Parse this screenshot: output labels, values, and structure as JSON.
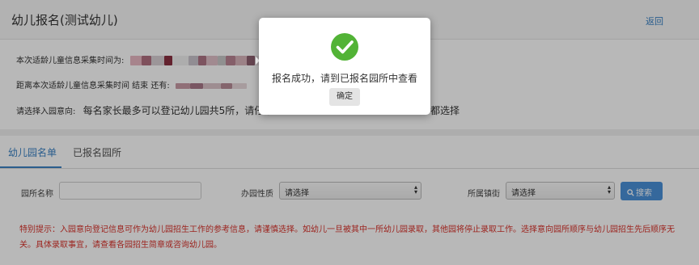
{
  "header": {
    "title": "幼儿报名(测试幼儿)",
    "back_label": "返回"
  },
  "info": {
    "collect_time_label": "本次适龄儿童信息采集时间为:",
    "remaining_label": "距离本次适龄儿童信息采集时间 结束 还有:",
    "select_label": "请选择入园意向:",
    "select_hint_visible": "每名家长最多可以登记幼儿园共5所，请仔细",
    "select_hint_tail": "都选择"
  },
  "tabs": [
    {
      "label": "幼儿园名单",
      "active": true
    },
    {
      "label": "已报名园所",
      "active": false
    }
  ],
  "filters": {
    "name_label": "园所名称",
    "name_value": "",
    "type_label": "办园性质",
    "type_value": "请选择",
    "town_label": "所属镇街",
    "town_value": "请选择",
    "search_label": "搜索"
  },
  "notice": {
    "text": "特别提示：入园意向登记信息可作为幼儿园招生工作的参考信息，请谨慎选择。如幼儿一旦被其中一所幼儿园录取，其他园将停止录取工作。选择意向园所顺序与幼儿园招生先后顺序无关。具体录取事宜，请查看各园招生简章或咨询幼儿园。"
  },
  "modal": {
    "icon": "checkmark-circle-icon",
    "message": "报名成功，请到已报名园所中查看",
    "confirm_label": "确定"
  },
  "colors": {
    "accent": "#3b82c4",
    "success": "#52b336",
    "notice_red": "#d9332b",
    "search_button": "#4a90d9"
  }
}
